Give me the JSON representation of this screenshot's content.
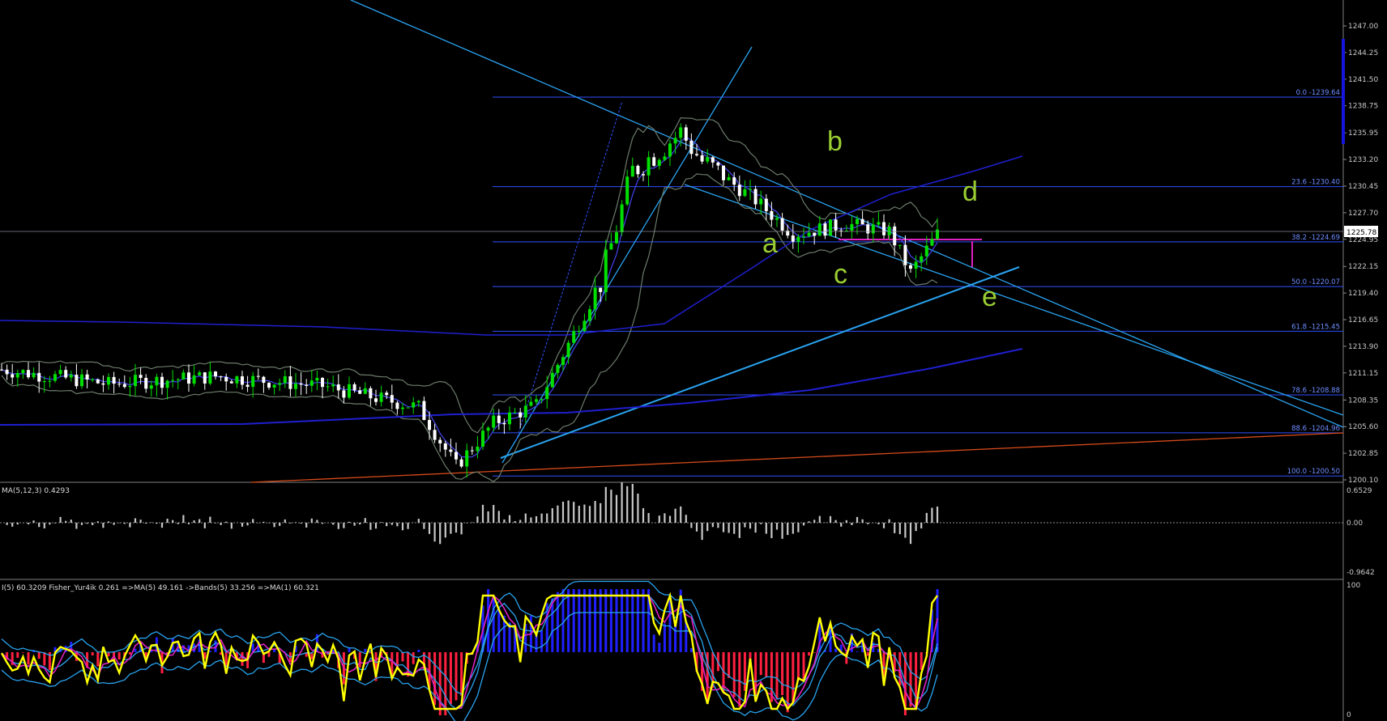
{
  "window": {
    "title_fragment": "",
    "colors": {
      "background": "#000000",
      "candle_up": "#00e000",
      "candle_down": "#ffffff",
      "fib_line": "#3050ff",
      "trend_line": "#29a3f0",
      "ma_slow": "#1f1fd0",
      "bollinger": "#6b7b6b",
      "wave_label": "#9acd32",
      "magenta": "#e020c0",
      "orange": "#d64a1a",
      "yellow": "#ffff00",
      "hist_pos": "#2020ff",
      "hist_neg": "#ff2040"
    }
  },
  "price_axis": {
    "labels": [
      "1247.00",
      "1244.25",
      "1241.50",
      "1238.75",
      "1235.95",
      "1233.20",
      "1230.45",
      "1227.70",
      "1224.95",
      "1222.15",
      "1219.40",
      "1216.65",
      "1213.90",
      "1211.15",
      "1208.35",
      "1205.60",
      "1202.85",
      "1200.10"
    ],
    "current_price": "1225.78"
  },
  "fibonacci": [
    {
      "label": "0.0 -1239.64",
      "price": 1239.64
    },
    {
      "label": "23.6 -1230.40",
      "price": 1230.4
    },
    {
      "label": "38.2 -1224.69",
      "price": 1224.69
    },
    {
      "label": "50.0 -1220.07",
      "price": 1220.07
    },
    {
      "label": "61.8 -1215.45",
      "price": 1215.45
    },
    {
      "label": "78.6 -1208.88",
      "price": 1208.88
    },
    {
      "label": "88.6 -1204.96",
      "price": 1204.96
    },
    {
      "label": "100.0 -1200.50",
      "price": 1200.5
    }
  ],
  "waves": [
    "a",
    "b",
    "c",
    "d",
    "e"
  ],
  "osma_panel": {
    "label": "MA(5,12,3) 0.4293",
    "scale": [
      "0.6529",
      "0.00",
      "-0.9642"
    ]
  },
  "fisher_panel": {
    "label": "I(5) 60.3209  Fisher_Yur4ik 0.261  =>MA(5) 49.161  ->Bands(5) 33.256  =>MA(1) 60.321",
    "scale": [
      "100",
      "0"
    ]
  }
}
